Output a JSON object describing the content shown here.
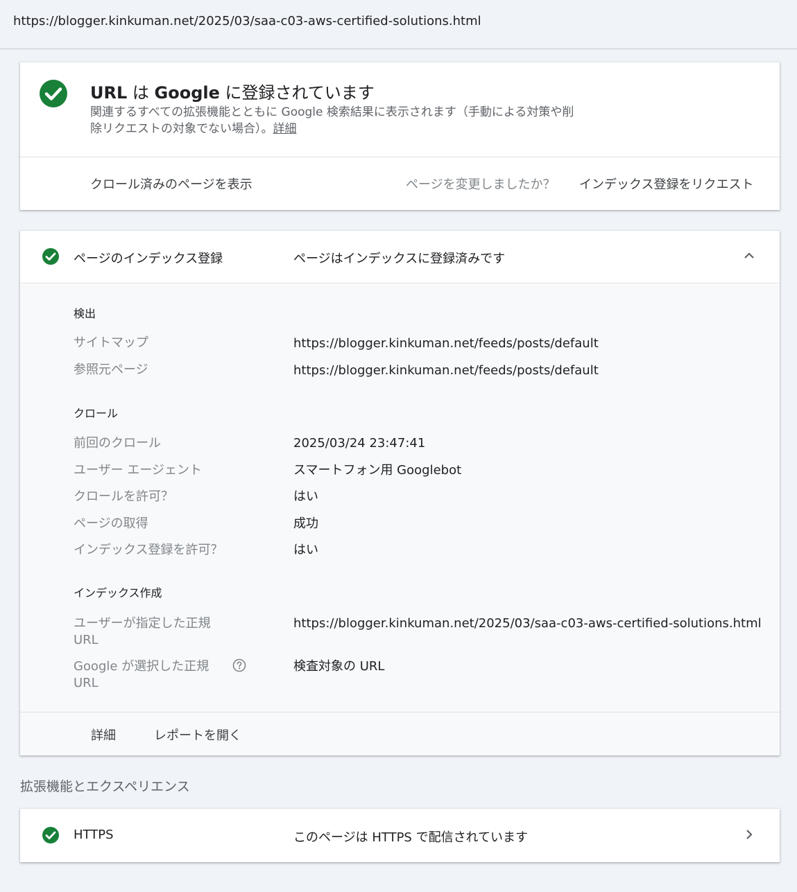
{
  "url": "https://blogger.kinkuman.net/2025/03/saa-c03-aws-certified-solutions.html",
  "colors": {
    "success": "#188038",
    "page_bg": "#f0f3f8"
  },
  "summary": {
    "title_part1": "URL",
    "title_part2": " は ",
    "title_part3": "Google",
    "title_part4": " に登録されています",
    "desc": "関連するすべての拡張機能とともに Google 検索結果に表示されます（手動による対策や削除リクエストの対象でない場合）。",
    "desc_link": "詳細",
    "view_crawled": "クロール済みのページを表示",
    "changed_question": "ページを変更しましたか？",
    "request_indexing": "インデックス登録をリクエスト"
  },
  "indexing": {
    "label": "ページのインデックス登録",
    "status": "ページはインデックスに登録済みです",
    "discovery": {
      "heading": "検出",
      "sitemap_label": "サイトマップ",
      "sitemap_value": "https://blogger.kinkuman.net/feeds/posts/default",
      "referring_label": "参照元ページ",
      "referring_value": "https://blogger.kinkuman.net/feeds/posts/default"
    },
    "crawl": {
      "heading": "クロール",
      "last_crawl_label": "前回のクロール",
      "last_crawl_value": "2025/03/24 23:47:41",
      "agent_label": "ユーザー エージェント",
      "agent_value": "スマートフォン用 Googlebot",
      "allowed_label": "クロールを許可？",
      "allowed_value": "はい",
      "fetch_label": "ページの取得",
      "fetch_value": "成功",
      "index_allowed_label": "インデックス登録を許可？",
      "index_allowed_value": "はい"
    },
    "indexing_section": {
      "heading": "インデックス作成",
      "user_canonical_label": "ユーザーが指定した正規 URL",
      "user_canonical_value": "https://blogger.kinkuman.net/2025/03/saa-c03-aws-certified-solutions.html",
      "google_canonical_label": "Google が選択した正規 URL",
      "google_canonical_value": "検査対象の URL"
    },
    "footer": {
      "details": "詳細",
      "open_report": "レポートを開く"
    }
  },
  "enhancements": {
    "title": "拡張機能とエクスペリエンス",
    "https_label": "HTTPS",
    "https_status": "このページは HTTPS で配信されています"
  }
}
